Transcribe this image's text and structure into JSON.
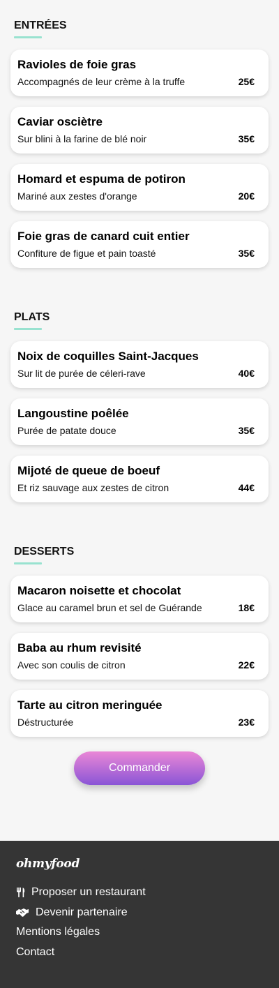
{
  "sections": [
    {
      "title": "ENTRÉES",
      "dishes": [
        {
          "name": "Ravioles de foie gras",
          "description": "Accompagnés de leur crème à la truffe",
          "price": "25€"
        },
        {
          "name": "Caviar osciètre",
          "description": "Sur blini à la farine de blé noir",
          "price": "35€"
        },
        {
          "name": "Homard et espuma de potiron",
          "description": "Mariné aux zestes d'orange",
          "price": "20€"
        },
        {
          "name": "Foie gras de canard cuit entier",
          "description": "Confiture de figue et pain toasté",
          "price": "35€"
        }
      ]
    },
    {
      "title": "PLATS",
      "dishes": [
        {
          "name": "Noix de coquilles Saint-Jacques",
          "description": "Sur lit de purée de céleri-rave",
          "price": "40€"
        },
        {
          "name": "Langoustine poêlée",
          "description": "Purée de patate douce",
          "price": "35€"
        },
        {
          "name": "Mijoté de queue de boeuf",
          "description": "Et riz sauvage aux zestes de citron",
          "price": "44€"
        }
      ]
    },
    {
      "title": "DESSERTS",
      "dishes": [
        {
          "name": "Macaron noisette et chocolat",
          "description": "Glace au caramel brun et sel de Guérande",
          "price": "18€"
        },
        {
          "name": "Baba au rhum revisité",
          "description": "Avec son coulis de citron",
          "price": "22€"
        },
        {
          "name": "Tarte au citron meringuée",
          "description": "Déstructurée",
          "price": "23€"
        }
      ]
    }
  ],
  "cta": {
    "label": "Commander"
  },
  "footer": {
    "logo": "ohmyfood",
    "links": [
      {
        "label": "Proposer un restaurant",
        "icon": "utensils-icon"
      },
      {
        "label": "Devenir partenaire",
        "icon": "handshake-icon"
      },
      {
        "label": "Mentions légales",
        "icon": ""
      },
      {
        "label": "Contact",
        "icon": ""
      }
    ]
  },
  "colors": {
    "accent_underline": "#99e2d0",
    "button_top": "#ea87d6",
    "button_bottom": "#8a55d6",
    "footer_bg": "#353535",
    "page_bg": "#f6f6f6"
  }
}
